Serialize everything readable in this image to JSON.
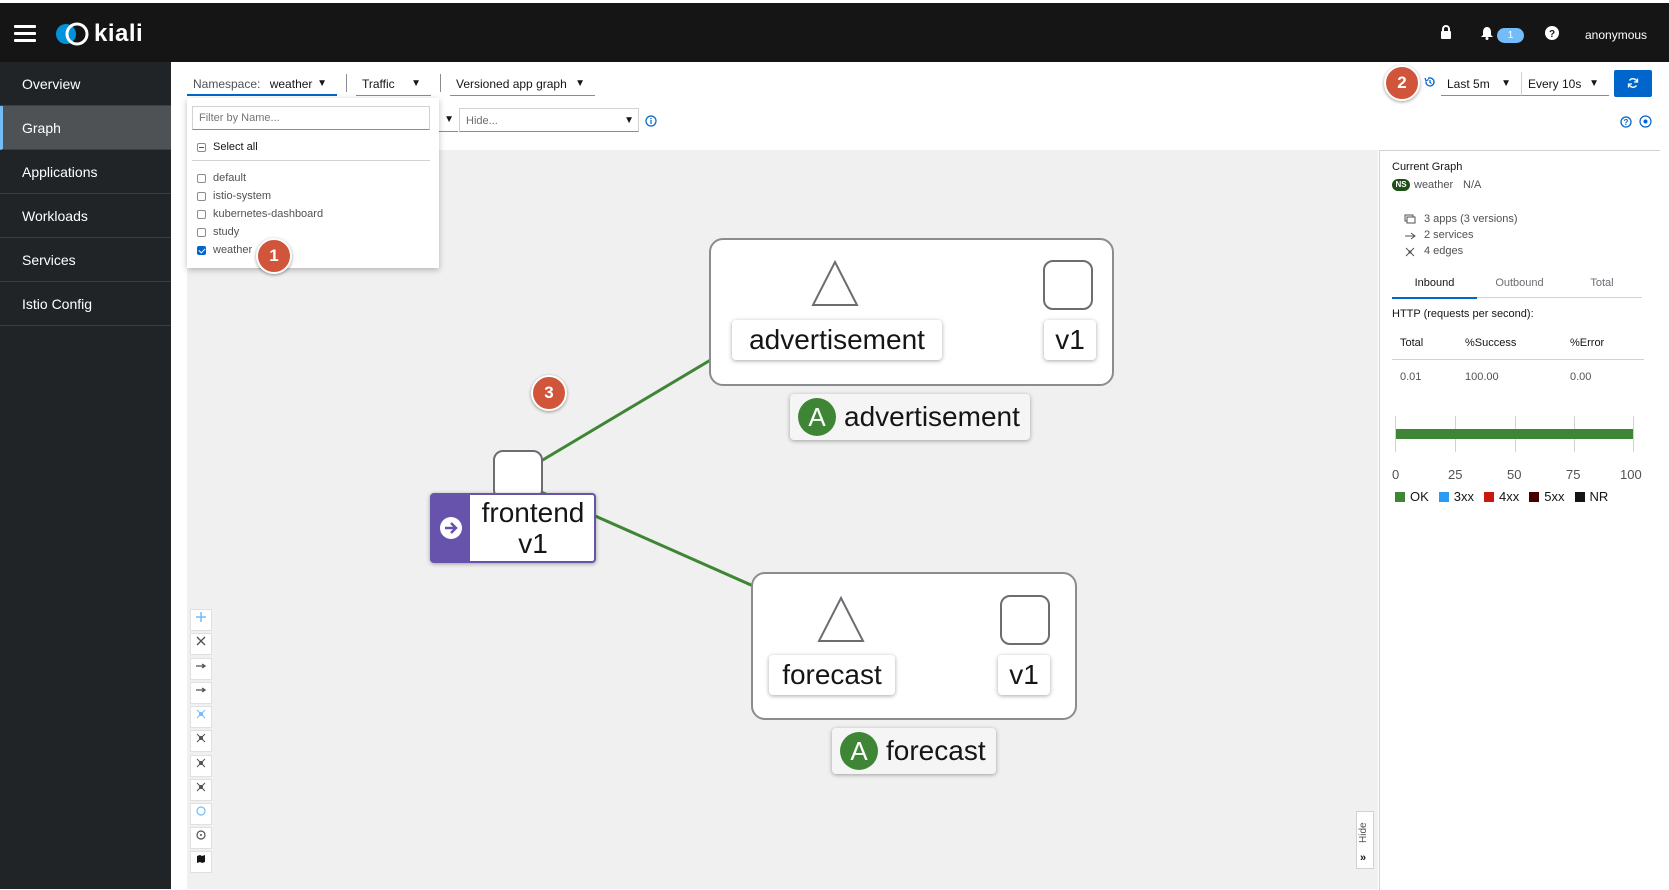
{
  "masthead": {
    "logo_text": "kiali",
    "notification_count": "1",
    "user": "anonymous"
  },
  "sidebar": {
    "items": [
      {
        "label": "Overview"
      },
      {
        "label": "Graph",
        "active": true
      },
      {
        "label": "Applications"
      },
      {
        "label": "Workloads"
      },
      {
        "label": "Services"
      },
      {
        "label": "Istio Config"
      }
    ]
  },
  "toolbar": {
    "namespace_label": "Namespace:",
    "namespace_value": "weather",
    "traffic": "Traffic",
    "graph_type": "Versioned app graph",
    "time_range": "Last 5m",
    "refresh_interval": "Every 10s",
    "hide_placeholder": "Hide..."
  },
  "namespace_menu": {
    "filter_placeholder": "Filter by Name...",
    "select_all": "Select all",
    "namespaces": [
      {
        "name": "default",
        "checked": false
      },
      {
        "name": "istio-system",
        "checked": false
      },
      {
        "name": "kubernetes-dashboard",
        "checked": false
      },
      {
        "name": "study",
        "checked": false
      },
      {
        "name": "weather",
        "checked": true
      }
    ]
  },
  "callouts": [
    "1",
    "2",
    "3"
  ],
  "graph": {
    "advertisement_service": "advertisement",
    "advertisement_version": "v1",
    "advertisement_app": "advertisement",
    "app_badge": "A",
    "frontend_name": "frontend",
    "frontend_version": "v1",
    "forecast_service": "forecast",
    "forecast_version": "v1",
    "forecast_app": "forecast",
    "hide_label": "Hide"
  },
  "panel": {
    "title": "Current Graph",
    "ns_badge": "NS",
    "namespace": "weather",
    "namespace_extra": "N/A",
    "apps": "3 apps (3 versions)",
    "services": "2 services",
    "edges": "4 edges",
    "tabs": [
      "Inbound",
      "Outbound",
      "Total"
    ],
    "http_title": "HTTP (requests per second):",
    "table_headers": [
      "Total",
      "%Success",
      "%Error"
    ],
    "table_values": [
      "0.01",
      "100.00",
      "0.00"
    ],
    "axis_ticks": [
      "0",
      "25",
      "50",
      "75",
      "100"
    ],
    "legend": [
      {
        "label": "OK",
        "color": "#3e8635"
      },
      {
        "label": "3xx",
        "color": "#2b9af3"
      },
      {
        "label": "4xx",
        "color": "#c9190b"
      },
      {
        "label": "5xx",
        "color": "#470000"
      },
      {
        "label": "NR",
        "color": "#151515"
      }
    ],
    "ok_percent": 100
  },
  "colors": {
    "edge": "#3e8635",
    "primary": "#0066cc",
    "callout": "#d0553b",
    "workload_root": "#6753ac"
  }
}
